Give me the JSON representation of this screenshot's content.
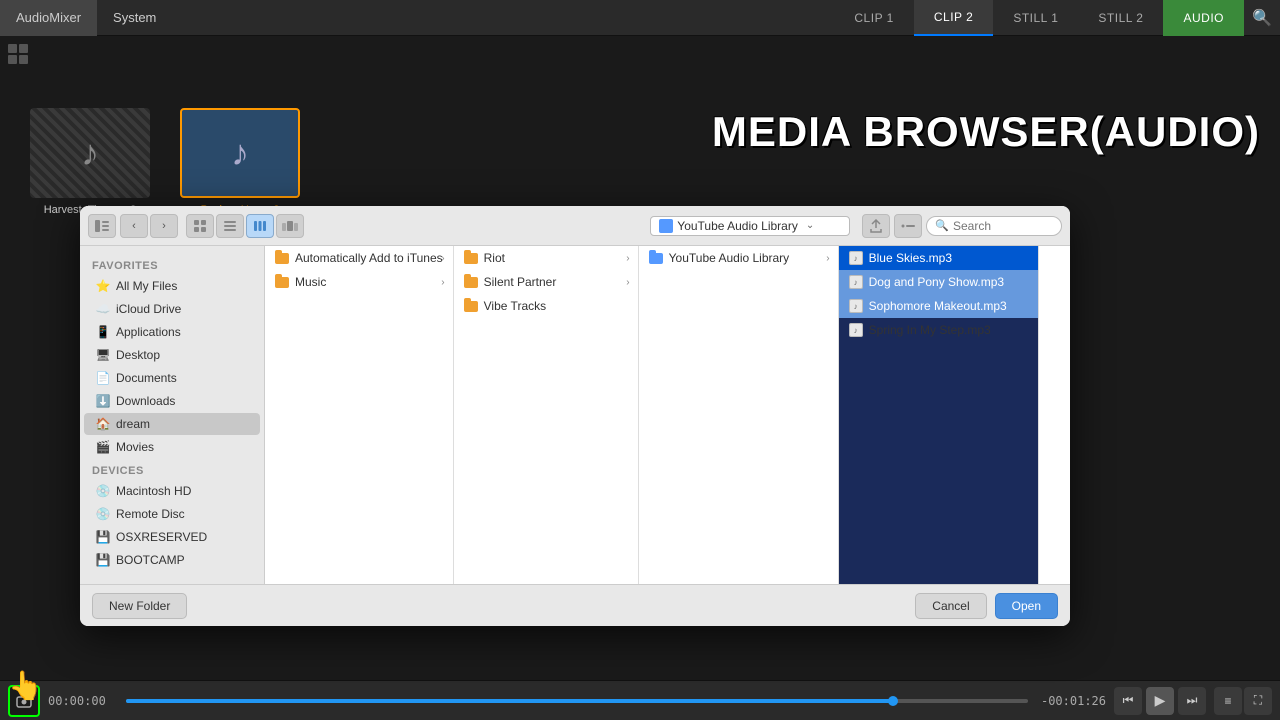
{
  "topbar": {
    "menu_items": [
      "AudioMixer",
      "System"
    ],
    "tabs": [
      {
        "label": "CLIP 1",
        "active": false
      },
      {
        "label": "CLIP 2",
        "active": true
      },
      {
        "label": "STILL 1",
        "active": false
      },
      {
        "label": "STILL 2",
        "active": false
      },
      {
        "label": "AUDIO",
        "active": true,
        "audio": true
      }
    ],
    "search_icon": "🔍"
  },
  "track_area": {
    "item1": {
      "label": "Harvest_Time.mp3",
      "selected": false
    },
    "item2": {
      "label": "Pucker_Up.mp3",
      "selected": true
    }
  },
  "media_browser_label": "MEDIA BROWSER(AUDIO)",
  "file_browser": {
    "toolbar": {
      "location_icon": "📁",
      "location_text": "YouTube Audio Library",
      "search_placeholder": "Search"
    },
    "sidebar": {
      "favorites_label": "Favorites",
      "favorites": [
        {
          "icon": "⭐",
          "label": "All My Files"
        },
        {
          "icon": "☁️",
          "label": "iCloud Drive"
        },
        {
          "icon": "📱",
          "label": "Applications"
        },
        {
          "icon": "🖥",
          "label": "Desktop"
        },
        {
          "icon": "📄",
          "label": "Documents"
        },
        {
          "icon": "⬇️",
          "label": "Downloads"
        },
        {
          "icon": "🏠",
          "label": "dream",
          "active": true
        },
        {
          "icon": "🎬",
          "label": "Movies"
        }
      ],
      "devices_label": "Devices",
      "devices": [
        {
          "icon": "💿",
          "label": "Macintosh HD"
        },
        {
          "icon": "💿",
          "label": "Remote Disc"
        },
        {
          "icon": "💾",
          "label": "OSXRESERVED"
        },
        {
          "icon": "💾",
          "label": "BOOTCAMP"
        }
      ]
    },
    "columns": [
      {
        "items": [
          {
            "label": "Automatically Add to iTunes",
            "type": "folder",
            "has_arrow": true,
            "selected": false
          },
          {
            "label": "Music",
            "type": "folder",
            "has_arrow": true,
            "selected": false
          }
        ]
      },
      {
        "items": [
          {
            "label": "Riot",
            "type": "folder",
            "has_arrow": true,
            "selected": false
          },
          {
            "label": "Silent Partner",
            "type": "folder",
            "has_arrow": true,
            "selected": false
          },
          {
            "label": "Vibe Tracks",
            "type": "folder",
            "has_arrow": false,
            "selected": false
          }
        ]
      },
      {
        "items": [
          {
            "label": "YouTube Audio Library",
            "type": "folder",
            "has_arrow": true,
            "selected": false
          }
        ]
      },
      {
        "items": [
          {
            "label": "Blue Skies.mp3",
            "type": "audio",
            "selected_blue": true
          },
          {
            "label": "Dog and Pony Show.mp3",
            "type": "audio",
            "selected_light": true
          },
          {
            "label": "Sophomore Makeout.mp3",
            "type": "audio",
            "selected_light": true
          },
          {
            "label": "Spring In My Step.mp3",
            "type": "audio",
            "selected_light": false
          }
        ]
      }
    ],
    "footer": {
      "new_folder_btn": "New Folder",
      "cancel_btn": "Cancel",
      "open_btn": "Open"
    }
  },
  "bottom_bar": {
    "time_start": "00:00:00",
    "time_end": "-00:01:26",
    "progress_pct": 85
  }
}
